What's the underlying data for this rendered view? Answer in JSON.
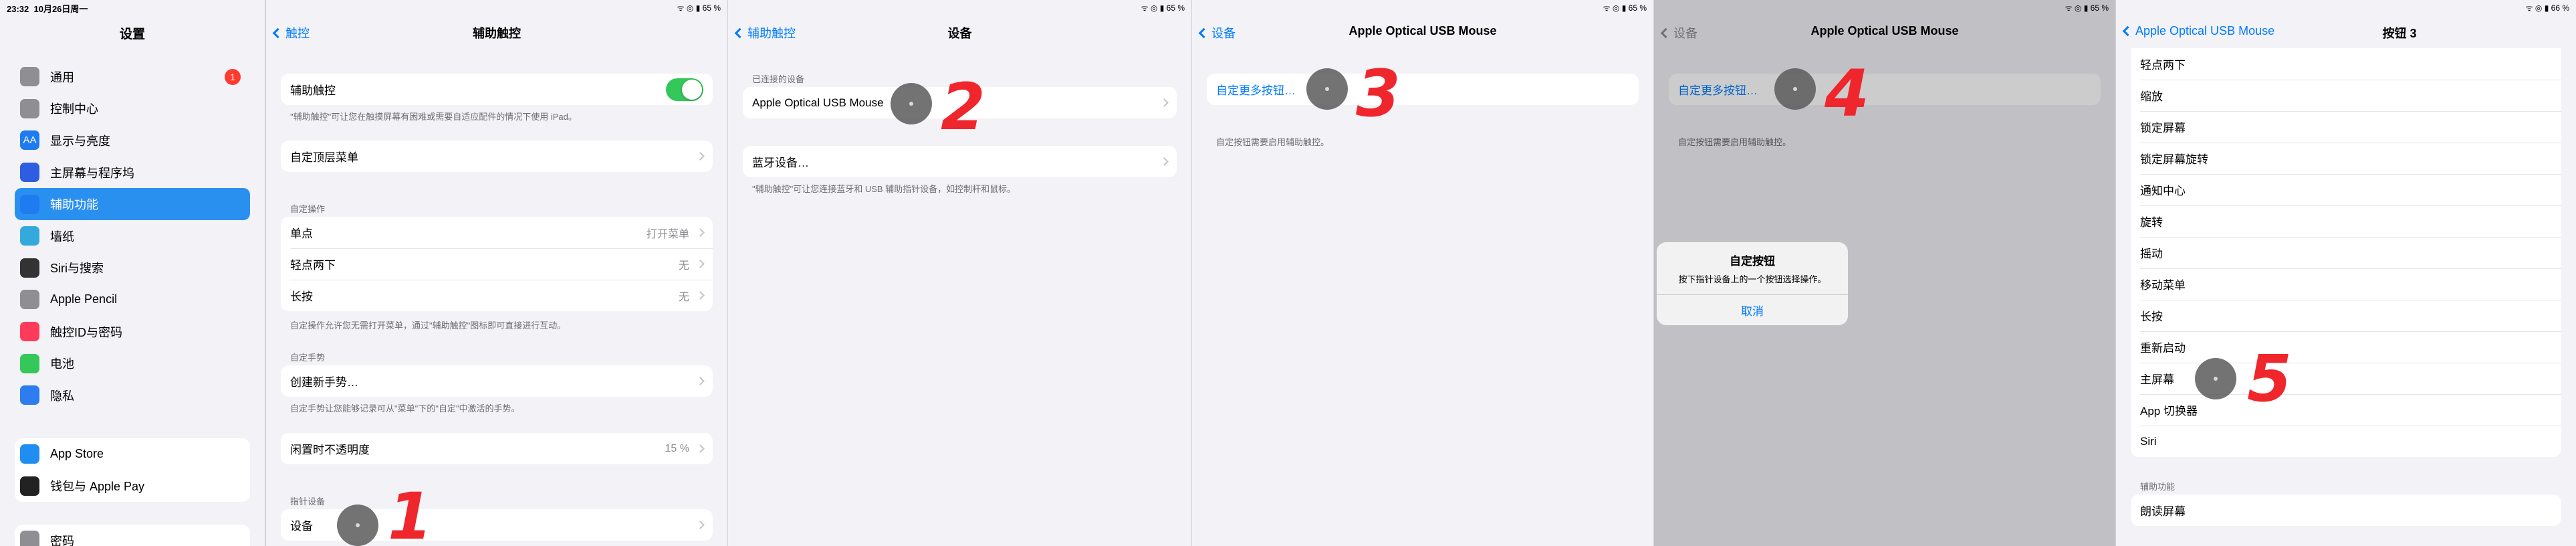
{
  "status": {
    "time": "23:32",
    "date": "10月26日周一",
    "battery1": "65 %",
    "battery2": "66 %"
  },
  "p1": {
    "title": "设置",
    "items_a": [
      {
        "label": "通用",
        "badge": "1",
        "color": "#8e8e93",
        "icon": "gear-icon"
      },
      {
        "label": "控制中心",
        "color": "#8e8e93",
        "icon": "switches-icon"
      },
      {
        "label": "显示与亮度",
        "color": "#1f7cf0",
        "icon": "text-size-icon",
        "glyph": "AA"
      },
      {
        "label": "主屏幕与程序坞",
        "color": "#2d5de0",
        "icon": "grid-icon"
      },
      {
        "label": "辅助功能",
        "color": "#1f7cf0",
        "icon": "accessibility-icon",
        "selected": true
      },
      {
        "label": "墙纸",
        "color": "#34aadc",
        "icon": "flower-icon"
      },
      {
        "label": "Siri与搜索",
        "color": "#333333",
        "icon": "siri-icon"
      },
      {
        "label": "Apple Pencil",
        "color": "#8e8e93",
        "icon": "pencil-icon"
      },
      {
        "label": "触控ID与密码",
        "color": "#ff3b5c",
        "icon": "fingerprint-icon"
      },
      {
        "label": "电池",
        "color": "#34c759",
        "icon": "battery-icon"
      },
      {
        "label": "隐私",
        "color": "#2d7cf0",
        "icon": "hand-icon"
      }
    ],
    "items_b": [
      {
        "label": "App Store",
        "color": "#1f8ef0",
        "icon": "app-store-icon"
      },
      {
        "label": "钱包与 Apple Pay",
        "color": "#222222",
        "icon": "wallet-icon"
      }
    ],
    "items_c": [
      {
        "label": "密码",
        "color": "#8e8e93",
        "icon": "key-icon"
      }
    ]
  },
  "p2": {
    "back": "触控",
    "title": "辅助触控",
    "assistive": "辅助触控",
    "assistive_footer": "\"辅助触控\"可让您在触摸屏幕有困难或需要自适应配件的情况下使用 iPad。",
    "custom_menu": "自定顶层菜单",
    "custom_actions_header": "自定操作",
    "actions": [
      {
        "label": "单点",
        "value": "打开菜单"
      },
      {
        "label": "轻点两下",
        "value": "无"
      },
      {
        "label": "长按",
        "value": "无"
      }
    ],
    "actions_footer": "自定操作允许您无需打开菜单，通过\"辅助触控\"图标即可直接进行互动。",
    "gestures_header": "自定手势",
    "create_gesture": "创建新手势…",
    "gestures_footer": "自定手势让您能够记录可从\"菜单\"下的\"自定\"中激活的手势。",
    "idle_opacity": "闲置时不透明度",
    "idle_value": "15 %",
    "pointer_header": "指针设备",
    "devices": "设备",
    "step": "1"
  },
  "p3": {
    "back": "辅助触控",
    "title": "设备",
    "connected_header": "已连接的设备",
    "device": "Apple Optical USB Mouse",
    "bluetooth": "蓝牙设备…",
    "footer": "\"辅助触控\"可让您连接蓝牙和 USB 辅助指针设备，如控制杆和鼠标。",
    "step": "2"
  },
  "p4": {
    "back": "设备",
    "title": "Apple Optical USB Mouse",
    "customize": "自定更多按钮…",
    "footer": "自定按钮需要启用辅助触控。",
    "step": "3"
  },
  "p5": {
    "back": "设备",
    "title": "Apple Optical USB Mouse",
    "customize": "自定更多按钮…",
    "footer": "自定按钮需要启用辅助触控。",
    "alert_title": "自定按钮",
    "alert_msg": "按下指针设备上的一个按钮选择操作。",
    "alert_cancel": "取消",
    "step": "4"
  },
  "p6": {
    "back": "Apple Optical USB Mouse",
    "title": "按钮 3",
    "options": [
      "轻点两下",
      "缩放",
      "锁定屏幕",
      "锁定屏幕旋转",
      "通知中心",
      "旋转",
      "摇动",
      "移动菜单",
      "长按",
      "重新启动",
      "主屏幕",
      "App 切换器",
      "Siri"
    ],
    "accessibility_header": "辅助功能",
    "accessibility_options": [
      "朗读屏幕"
    ],
    "step": "5"
  },
  "colors": {
    "accent": "#007aff",
    "toggle_on": "#34c759",
    "annotation": "#f0262d"
  }
}
